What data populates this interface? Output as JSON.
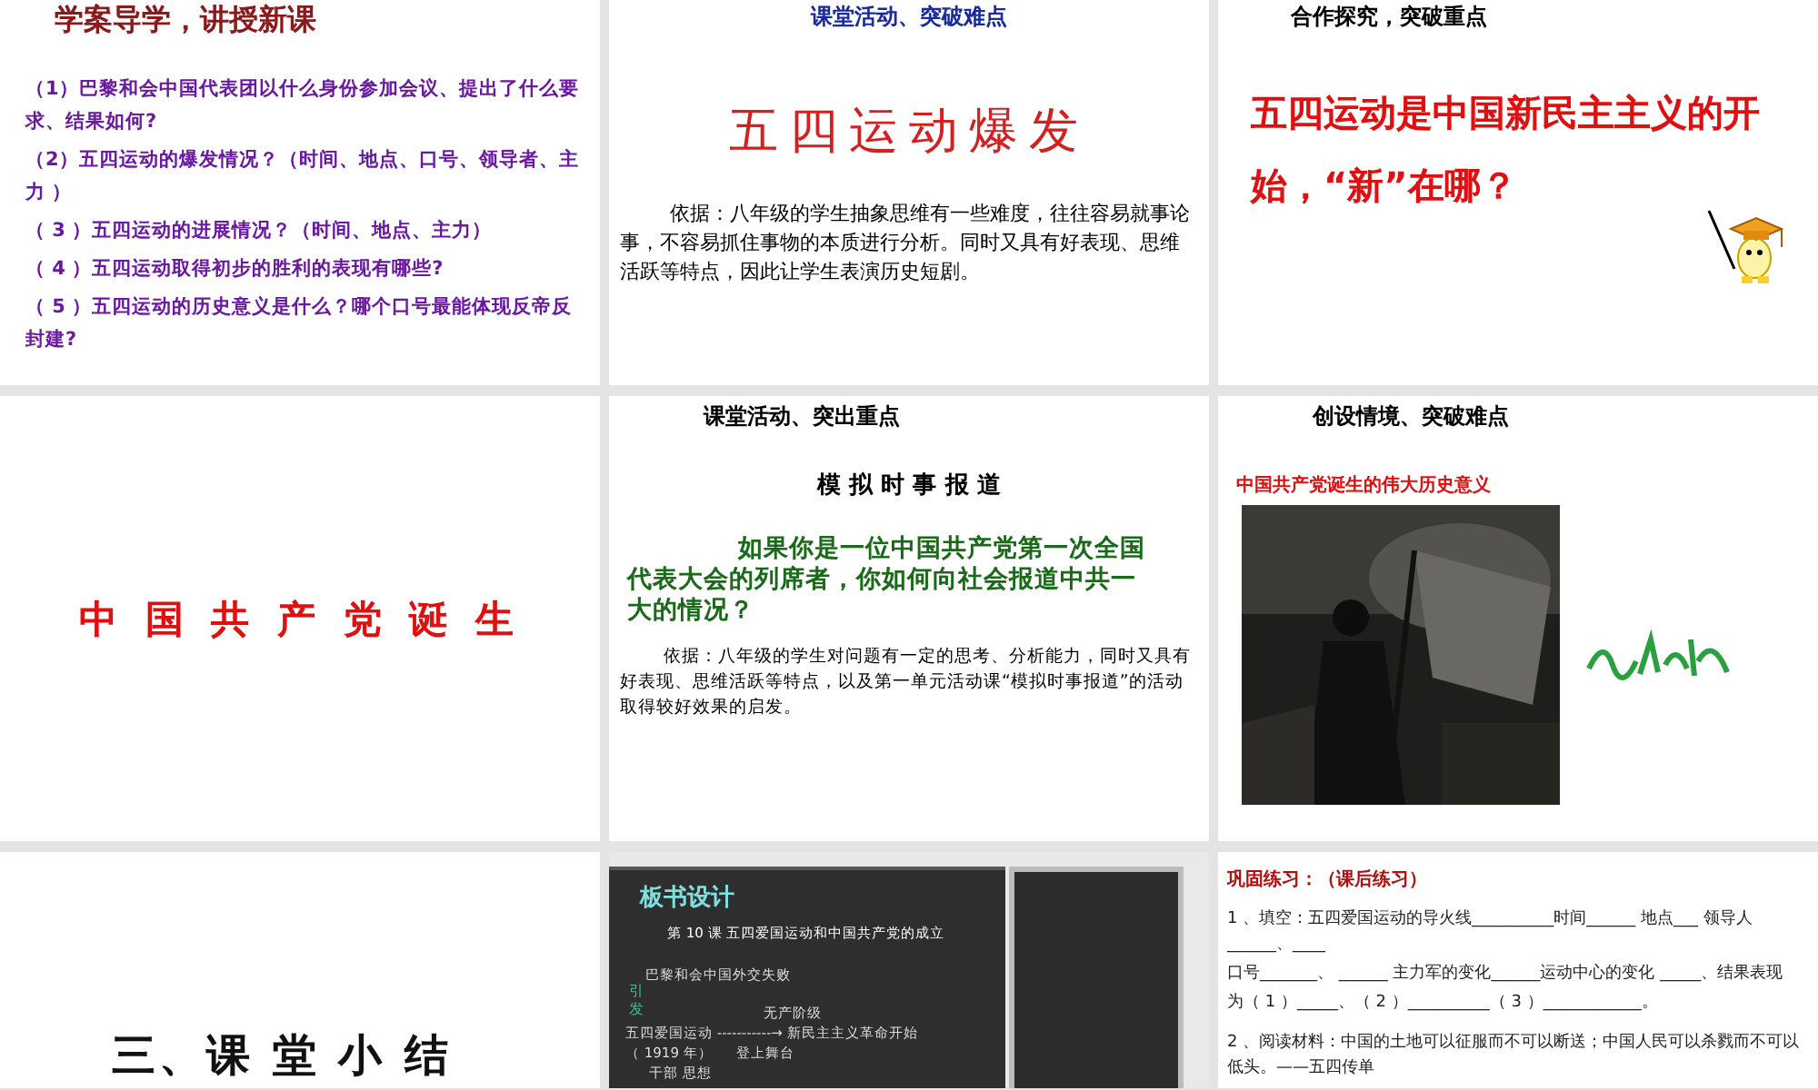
{
  "slides": [
    {
      "kind": "questions",
      "title": "学案导学，讲授新课",
      "items": [
        "（1）巴黎和会中国代表团以什么身份参加会议、提出了什么要求、结果如何?",
        "（2）五四运动的爆发情况？（时间、地点、口号、领导者、主力 ）",
        "（ 3 ）五四运动的进展情况？（时间、地点、主力）",
        "（ 4 ）五四运动取得初步的胜利的表现有哪些?",
        "（ 5 ）五四运动的历史意义是什么？哪个口号最能体现反帝反封建?"
      ]
    },
    {
      "kind": "heading",
      "title": "课堂活动、突破难点",
      "heading": "五四运动爆发",
      "body": "依据：八年级的学生抽象思维有一些难度，往往容易就事论事，不容易抓住事物的本质进行分析。同时又具有好表现、思维活跃等特点，因此让学生表演历史短剧。"
    },
    {
      "kind": "question",
      "title": "合作探究，突破重点",
      "question": "五四运动是中国新民主主义的开始，“新”在哪？"
    },
    {
      "kind": "banner",
      "heading": "中 国 共 产 党 诞 生"
    },
    {
      "kind": "task",
      "title": "课堂活动、突出重点",
      "subtitle": "模 拟 时 事 报 道",
      "question": "如果你是一位中国共产党第一次全国代表大会的列席者，你如何向社会报道中共一大的情况？",
      "body": "依据：八年级的学生对问题有一定的思考、分析能力，同时又具有好表现、思维活跃等特点，以及第一单元活动课“模拟时事报道”的活动取得较好效果的启发。"
    },
    {
      "title": "创设情境、突破难点",
      "caption": "中国共产党诞生的伟大历史意义"
    },
    {
      "kind": "banner",
      "heading": "三、课 堂 小 结"
    },
    {
      "kind": "board",
      "title": "板书设计",
      "lesson": "第 10 课  五四爱国运动和中国共产党的成立",
      "lines": [
        "巴黎和会中国外交失败",
        "无产阶级",
        "五四爱国运动 -----------→ 新民主主义革命开始",
        "（ 1919 年）",
        "登上舞台",
        "干部   思想"
      ],
      "side": [
        "引",
        "发"
      ]
    },
    {
      "kind": "exercise",
      "title": "巩固练习：（课后练习）",
      "items": [
        "1 、填空：五四爱国运动的导火线__________时间______  地点___ 领导人______、____",
        "口号_______、 ______  主力军的变化______运动中心的变化 _____、结果表现",
        "为（ 1 ）_____、（ 2 ）__________（ 3 ）____________。",
        "2 、阅读材料：中国的土地可以征服而不可以断送；中国人民可以杀戮而不可以低头。——五四传单"
      ]
    }
  ]
}
